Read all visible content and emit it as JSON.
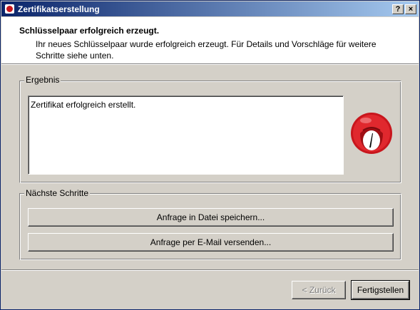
{
  "window": {
    "title": "Zertifikatserstellung",
    "help_label": "?",
    "close_label": "×"
  },
  "header": {
    "title": "Schlüsselpaar erfolgreich erzeugt.",
    "description": "Ihr neues Schlüsselpaar wurde erfolgreich erzeugt. Für Details und Vorschläge für weitere Schritte siehe unten."
  },
  "result": {
    "label": "Ergebnis",
    "text": "Zertifikat erfolgreich erstellt."
  },
  "next_steps": {
    "label": "Nächste Schritte",
    "save_label": "Anfrage in Datei speichern...",
    "email_label": "Anfrage per E-Mail versenden..."
  },
  "footer": {
    "back_label": "< Zurück",
    "finish_label": "Fertigstellen"
  },
  "colors": {
    "accent": "#0a246a",
    "logo_red": "#c8161d"
  },
  "logo_icon": "red-gnupg-logo-icon"
}
